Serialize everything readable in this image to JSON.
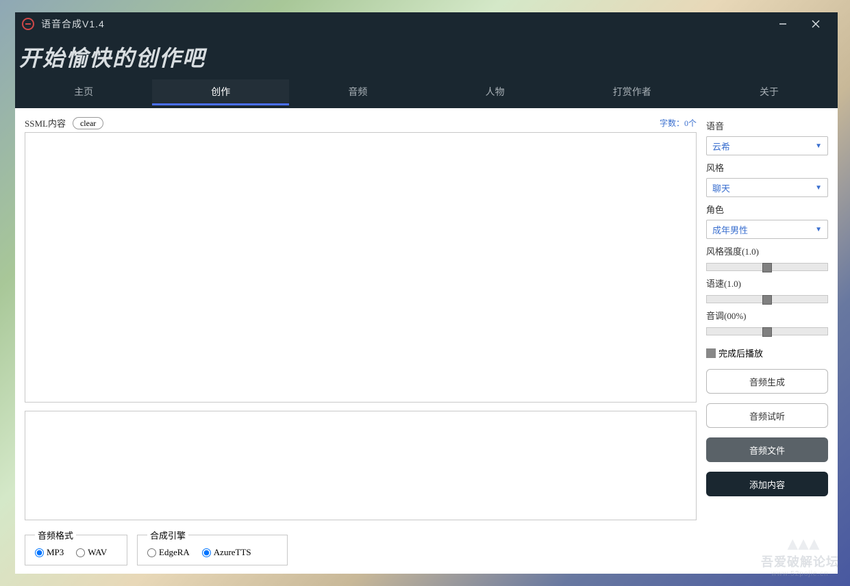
{
  "window": {
    "title": "语音合成V1.4"
  },
  "header": {
    "tagline": "开始愉快的创作吧"
  },
  "tabs": [
    {
      "key": "home",
      "label": "主页"
    },
    {
      "key": "create",
      "label": "创作"
    },
    {
      "key": "audio",
      "label": "音频"
    },
    {
      "key": "character",
      "label": "人物"
    },
    {
      "key": "donate",
      "label": "打赏作者"
    },
    {
      "key": "about",
      "label": "关于"
    }
  ],
  "active_tab": "create",
  "ssml": {
    "label": "SSML内容",
    "clear_label": "clear",
    "word_count": "字数：0个",
    "content": "",
    "secondary_content": ""
  },
  "audio_format": {
    "legend": "音频格式",
    "options": [
      "MP3",
      "WAV"
    ],
    "selected": "MP3"
  },
  "engine": {
    "legend": "合成引擎",
    "options": [
      "EdgeRA",
      "AzureTTS"
    ],
    "selected": "AzureTTS"
  },
  "panel": {
    "voice": {
      "label": "语音",
      "value": "云希"
    },
    "style": {
      "label": "风格",
      "value": "聊天"
    },
    "role": {
      "label": "角色",
      "value": "成年男性"
    },
    "style_strength": {
      "label": "风格强度(1.0)",
      "percent": 50
    },
    "speed": {
      "label": "语速(1.0)",
      "percent": 50
    },
    "pitch": {
      "label": "音调(00%)",
      "percent": 50
    },
    "play_after": {
      "label": "完成后播放",
      "checked": false
    }
  },
  "buttons": {
    "generate": "音频生成",
    "preview": "音频试听",
    "files": "音频文件",
    "add": "添加内容"
  },
  "watermark": {
    "text": "吾爱破解论坛",
    "sub": "www.52pojie.cn"
  }
}
